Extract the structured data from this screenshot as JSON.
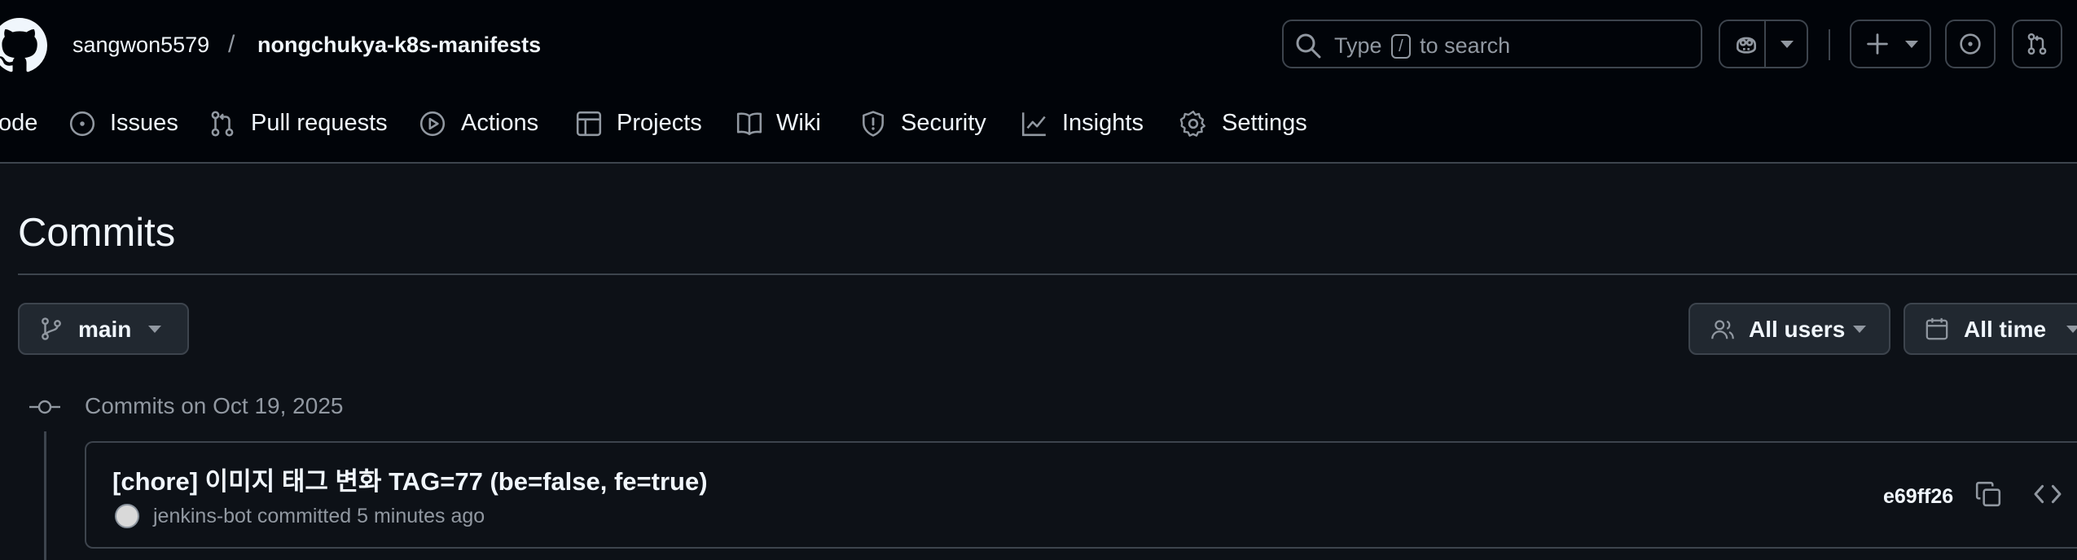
{
  "header": {
    "owner": "sangwon5579",
    "separator": "/",
    "repo": "nongchukya-k8s-manifests",
    "search": {
      "prefix": "Type",
      "key": "/",
      "suffix": "to search"
    }
  },
  "nav": {
    "items": [
      {
        "label": "ode",
        "icon": "code-icon"
      },
      {
        "label": "Issues",
        "icon": "issue-icon"
      },
      {
        "label": "Pull requests",
        "icon": "pull-request-icon"
      },
      {
        "label": "Actions",
        "icon": "play-icon"
      },
      {
        "label": "Projects",
        "icon": "table-icon"
      },
      {
        "label": "Wiki",
        "icon": "book-icon"
      },
      {
        "label": "Security",
        "icon": "shield-icon"
      },
      {
        "label": "Insights",
        "icon": "graph-icon"
      },
      {
        "label": "Settings",
        "icon": "gear-icon"
      }
    ]
  },
  "page": {
    "title": "Commits"
  },
  "filters": {
    "branch": "main",
    "users": "All users",
    "time": "All time"
  },
  "commit_groups": [
    {
      "label": "Commits on Oct 19, 2025",
      "commits": [
        {
          "title": "[chore] 이미지 태그 변화 TAG=77 (be=false, fe=true)",
          "author": "jenkins-bot",
          "action": "committed",
          "time": "5 minutes ago",
          "sha": "e69ff26"
        }
      ]
    }
  ],
  "colors": {
    "background": "#0d1117",
    "header_background": "#010409",
    "border": "#3d444d",
    "text": "#f0f6fc",
    "muted": "#9198a1",
    "button": "#212830"
  }
}
